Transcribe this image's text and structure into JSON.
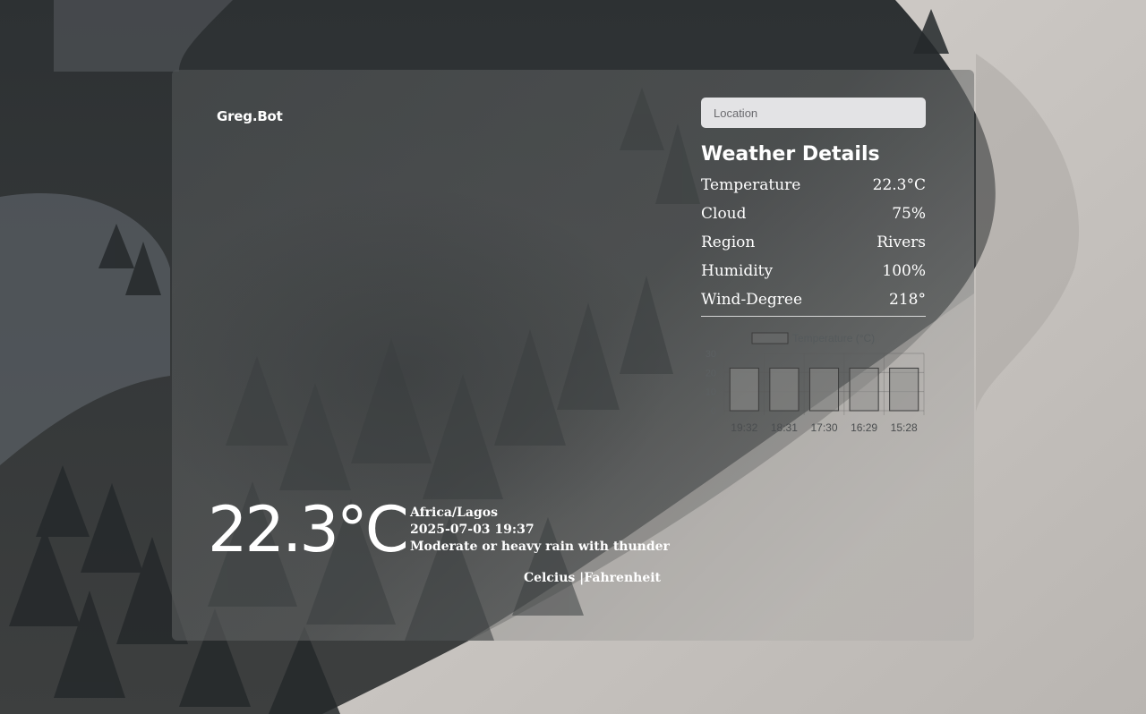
{
  "brand": "Greg.Bot",
  "current": {
    "temp_display": "22.3°C",
    "timezone": "Africa/Lagos",
    "datetime": "2025-07-03 19:37",
    "condition": "Moderate or heavy rain with thunder"
  },
  "units": {
    "celsius": "Celcius |",
    "fahrenheit": "Fahrenheit"
  },
  "search": {
    "placeholder": "Location"
  },
  "details": {
    "title": "Weather Details",
    "rows": [
      {
        "label": "Temperature",
        "value": "22.3°C"
      },
      {
        "label": "Cloud",
        "value": "75%"
      },
      {
        "label": "Region",
        "value": "Rivers"
      },
      {
        "label": "Humidity",
        "value": "100%"
      },
      {
        "label": "Wind-Degree",
        "value": "218°"
      }
    ]
  },
  "chart_data": {
    "type": "bar",
    "categories": [
      "19:32",
      "18:31",
      "17:30",
      "16:29",
      "15:28"
    ],
    "series": [
      {
        "name": "Temperature (°C)",
        "values": [
          22.3,
          22.3,
          22.3,
          22.3,
          22.3
        ]
      }
    ],
    "ylim": [
      0,
      30
    ],
    "yticks": [
      "0",
      "10",
      "20",
      "30"
    ],
    "grid": true,
    "legend": "top-center"
  },
  "colors": {
    "bar_fill": "#8e8e8c",
    "bar_stroke": "#3c3c3c",
    "text_white": "#ffffff"
  }
}
